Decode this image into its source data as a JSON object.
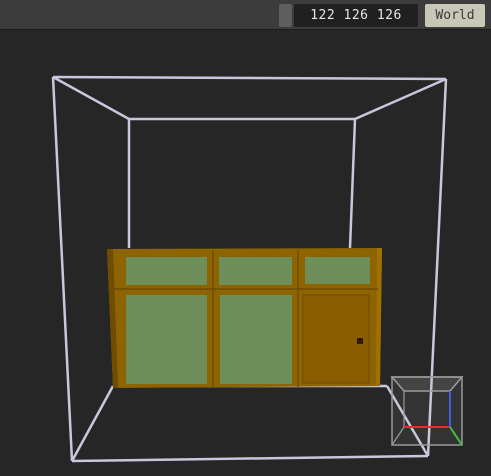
{
  "toolbar": {
    "coordinates": "122 126 126",
    "space_toggle_label": "World"
  },
  "viewport": {
    "model": "cabinet",
    "cabinet_colors": {
      "frame": "#8e6400",
      "frame_dark": "#6e4c00",
      "glass": "#6e8e5a",
      "door": "#8a5e00",
      "knob": "#2a1c08"
    },
    "bounding_box_color": "#c8c8dc",
    "gizmo": {
      "box_color": "#9a9a9a",
      "axes": [
        {
          "name": "x-axis",
          "color": "#e03030"
        },
        {
          "name": "y-axis",
          "color": "#40c040"
        },
        {
          "name": "z-axis",
          "color": "#4060e0"
        }
      ]
    }
  }
}
